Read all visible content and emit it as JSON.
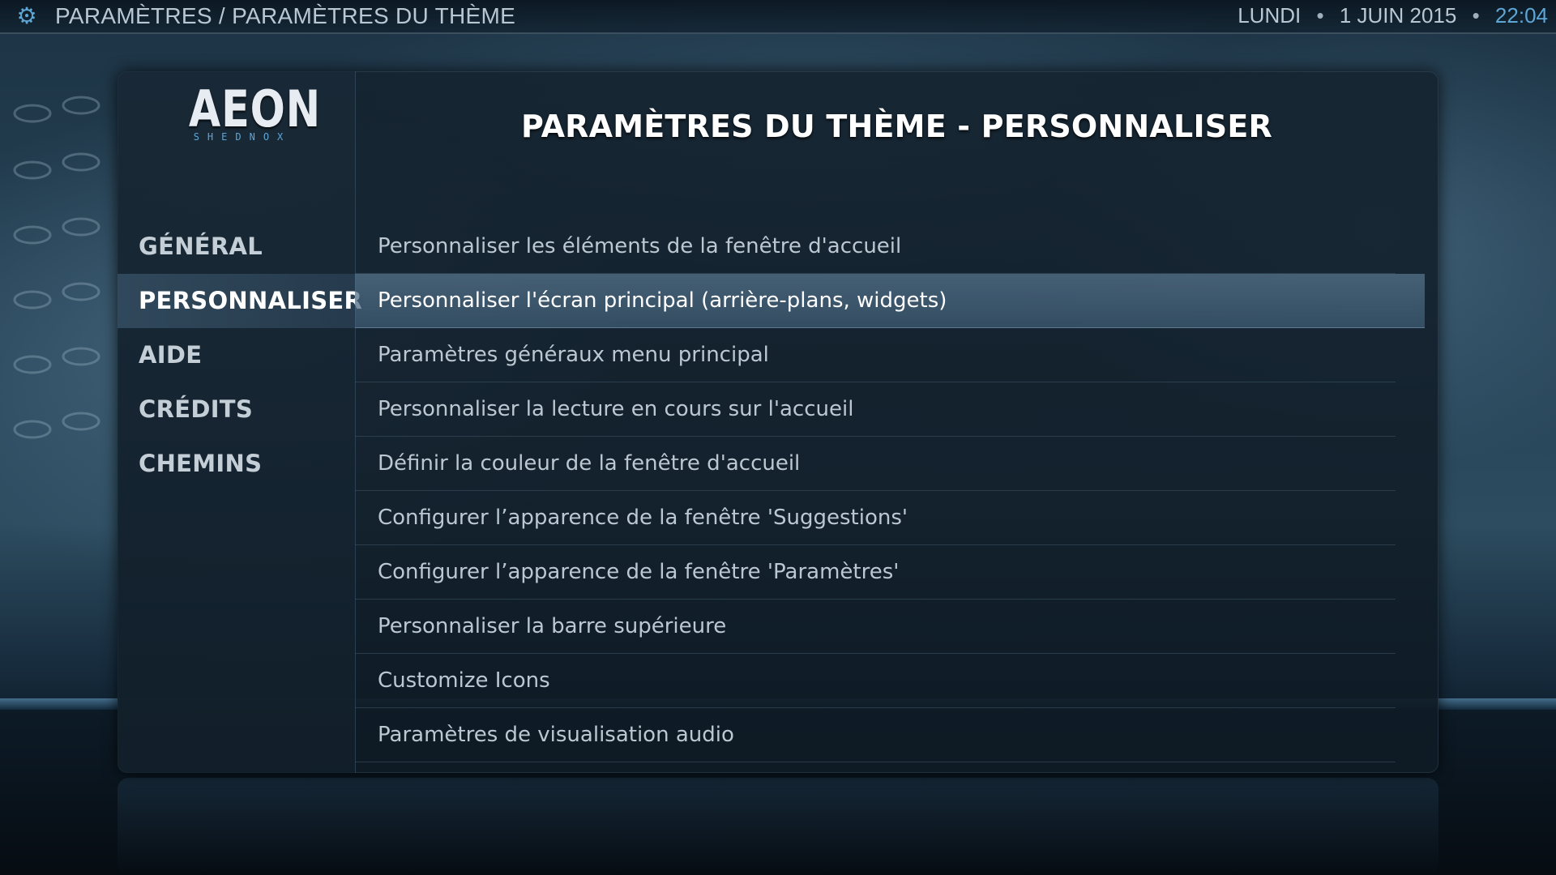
{
  "topbar": {
    "icon": "gear-icon",
    "breadcrumb": "PARAMÈTRES / PARAMÈTRES DU THÈME",
    "day": "LUNDI",
    "date": "1 JUIN 2015",
    "separator": "•",
    "time": "22:04"
  },
  "logo": {
    "word": "AEON",
    "sub": "SHEDNOX"
  },
  "sidebar": {
    "items": [
      {
        "label": "GÉNÉRAL",
        "active": false
      },
      {
        "label": "PERSONNALISER",
        "active": true
      },
      {
        "label": "AIDE",
        "active": false
      },
      {
        "label": "CRÉDITS",
        "active": false
      },
      {
        "label": "CHEMINS",
        "active": false
      }
    ]
  },
  "main": {
    "title": "PARAMÈTRES DU THÈME - PERSONNALISER",
    "items": [
      {
        "label": "Personnaliser les éléments de la fenêtre d'accueil",
        "active": false
      },
      {
        "label": "Personnaliser l'écran principal (arrière-plans, widgets)",
        "active": true
      },
      {
        "label": "Paramètres généraux menu principal",
        "active": false
      },
      {
        "label": "Personnaliser la lecture en cours sur l'accueil",
        "active": false
      },
      {
        "label": "Définir la couleur de la fenêtre d'accueil",
        "active": false
      },
      {
        "label": "Configurer l’apparence de la fenêtre 'Suggestions'",
        "active": false
      },
      {
        "label": "Configurer l’apparence de la fenêtre 'Paramètres'",
        "active": false
      },
      {
        "label": "Personnaliser la barre supérieure",
        "active": false
      },
      {
        "label": "Customize Icons",
        "active": false
      },
      {
        "label": "Paramètres de visualisation audio",
        "active": false
      }
    ]
  },
  "colors": {
    "accent": "#5ea6d6",
    "text": "#bcc8d1",
    "highlight": "#ffffff"
  }
}
